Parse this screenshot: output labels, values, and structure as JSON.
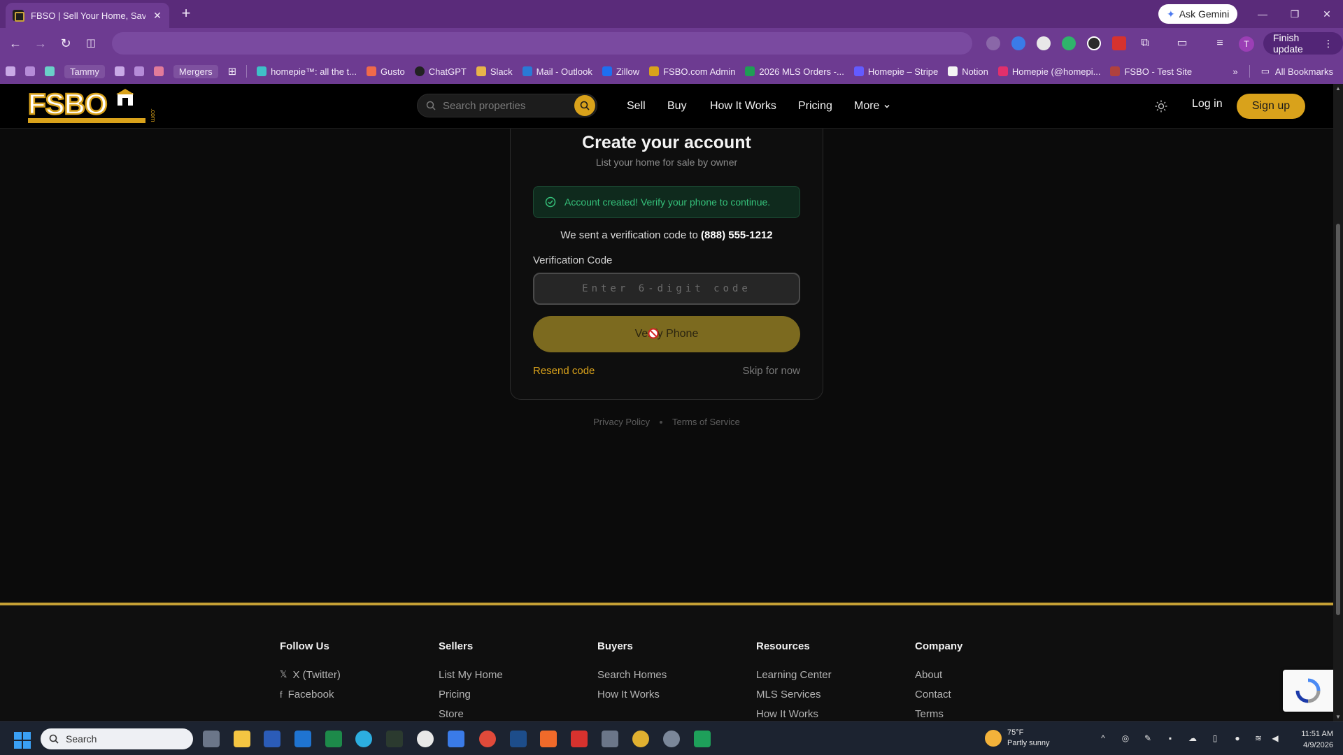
{
  "browser": {
    "tab_title": "FBSO | Sell Your Home, Save Th",
    "ask_gemini": "Ask Gemini",
    "avatar_letter": "T",
    "finish_update": "Finish update",
    "bookmarks": [
      {
        "label": "Tammy"
      },
      {
        "label": "Mergers"
      },
      {
        "label": "homepie™: all the t..."
      },
      {
        "label": "Gusto"
      },
      {
        "label": "ChatGPT"
      },
      {
        "label": "Slack"
      },
      {
        "label": "Mail - Outlook"
      },
      {
        "label": "Zillow"
      },
      {
        "label": "FSBO.com Admin"
      },
      {
        "label": "2026 MLS Orders -..."
      },
      {
        "label": "Homepie – Stripe"
      },
      {
        "label": "Notion"
      },
      {
        "label": "Homepie (@homepi..."
      },
      {
        "label": "FSBO - Test Site"
      }
    ],
    "all_bookmarks": "All Bookmarks"
  },
  "header": {
    "search_placeholder": "Search properties",
    "nav": [
      "Sell",
      "Buy",
      "How It Works",
      "Pricing",
      "More"
    ],
    "login": "Log in",
    "signup": "Sign up"
  },
  "card": {
    "title": "Create your account",
    "subtitle": "List your home for sale by owner",
    "alert": "Account created! Verify your phone to continue.",
    "sent_prefix": "We sent a verification code to ",
    "phone": "(888) 555-1212",
    "code_label": "Verification Code",
    "code_placeholder": "Enter 6-digit code",
    "verify_button": "Verify Phone",
    "resend": "Resend code",
    "skip": "Skip for now"
  },
  "legal": {
    "privacy": "Privacy Policy",
    "terms": "Terms of Service"
  },
  "footer": {
    "follow": {
      "title": "Follow Us",
      "links": [
        "X (Twitter)",
        "Facebook"
      ]
    },
    "sellers": {
      "title": "Sellers",
      "links": [
        "List My Home",
        "Pricing",
        "Store"
      ]
    },
    "buyers": {
      "title": "Buyers",
      "links": [
        "Search Homes",
        "How It Works"
      ]
    },
    "resources": {
      "title": "Resources",
      "links": [
        "Learning Center",
        "MLS Services",
        "How It Works"
      ]
    },
    "company": {
      "title": "Company",
      "links": [
        "About",
        "Contact",
        "Terms"
      ]
    }
  },
  "taskbar": {
    "search": "Search",
    "temp": "75°F",
    "weather": "Partly sunny",
    "time": "11:51 AM",
    "date": "4/9/2026"
  },
  "colors": {
    "accent": "#d9a21b",
    "success": "#35c07a",
    "browser_frame": "#6d3b91"
  }
}
